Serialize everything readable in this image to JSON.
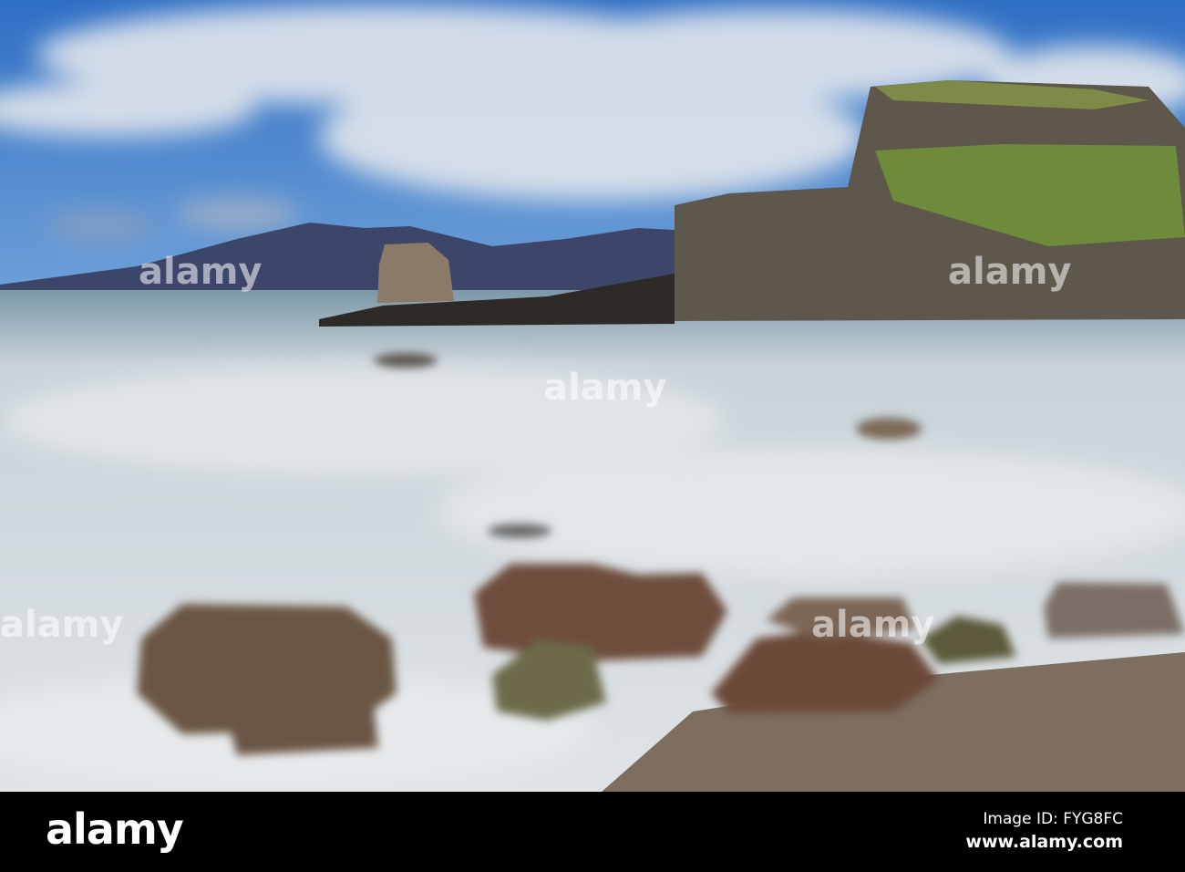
{
  "photo": {
    "subject": "Rocky coastline with long-exposure misty sea, sea stack and grassy cliff",
    "colors": {
      "sky": "#3a78c8",
      "cloud": "#dfe4ea",
      "mountain": "#3a4466",
      "sea": "#c9d2d8",
      "rock": "#6b5442",
      "cliff": "#5a5448",
      "grass": "#7a9a3a",
      "pebbles": "#8a7a6c"
    }
  },
  "watermark": {
    "text": "alamy"
  },
  "footer": {
    "logo": "alamy",
    "image_id": "Image ID: FYG8FC",
    "website": "www.alamy.com"
  }
}
